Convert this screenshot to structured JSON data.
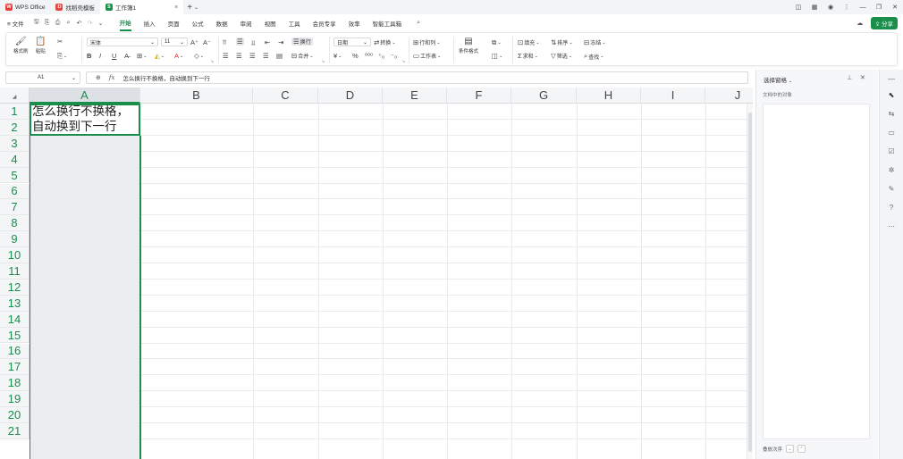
{
  "tabs": [
    {
      "label": "WPS Office",
      "logo": "W",
      "color": "#e43b3b"
    },
    {
      "label": "找稻壳模板",
      "logo": "D",
      "color": "#e4473d"
    },
    {
      "label": "工作簿1",
      "logo": "S",
      "color": "#1a8f4c",
      "active": true
    }
  ],
  "menu": {
    "file_label": "≡ 文件",
    "tabs": [
      "开始",
      "插入",
      "页面",
      "公式",
      "数据",
      "审阅",
      "视图",
      "工具",
      "会员专享",
      "效率",
      "智能工具箱"
    ],
    "active_tab": "开始",
    "share_label": "分享"
  },
  "ribbon": {
    "format_painter": "格式刷",
    "paste": "粘贴",
    "cut_menu": "✂",
    "font_name": "宋体",
    "font_size": "11",
    "wrap_text": "换行",
    "merge": "合并",
    "number_format": "日期",
    "convert": "转换",
    "rows_cols": "行和列",
    "worksheet": "工作表",
    "conditional_format": "条件格式",
    "fill": "填充",
    "sort": "排序",
    "freeze": "冻结",
    "sum": "求和",
    "filter": "筛选",
    "find": "查找"
  },
  "formula_bar": {
    "cell_ref": "A1",
    "content": "怎么换行不换格，自动换到下一行"
  },
  "grid": {
    "columns": [
      "A",
      "B",
      "C",
      "D",
      "E",
      "F",
      "G",
      "H",
      "I",
      "J"
    ],
    "rows": [
      "1",
      "2",
      "3",
      "4",
      "5",
      "6",
      "7",
      "8",
      "9",
      "10",
      "11",
      "12",
      "13",
      "14",
      "15",
      "16",
      "17",
      "18",
      "19",
      "20",
      "21"
    ],
    "selected_column": "A",
    "cell_a1": "怎么换行不换格，\n自动换到下一行"
  },
  "pane": {
    "title": "选择窗格",
    "subtitle": "文档中的对象",
    "footer": "叠放次序"
  },
  "colors": {
    "accent": "#1a8f4c",
    "selection_col": "#ebedf0"
  }
}
